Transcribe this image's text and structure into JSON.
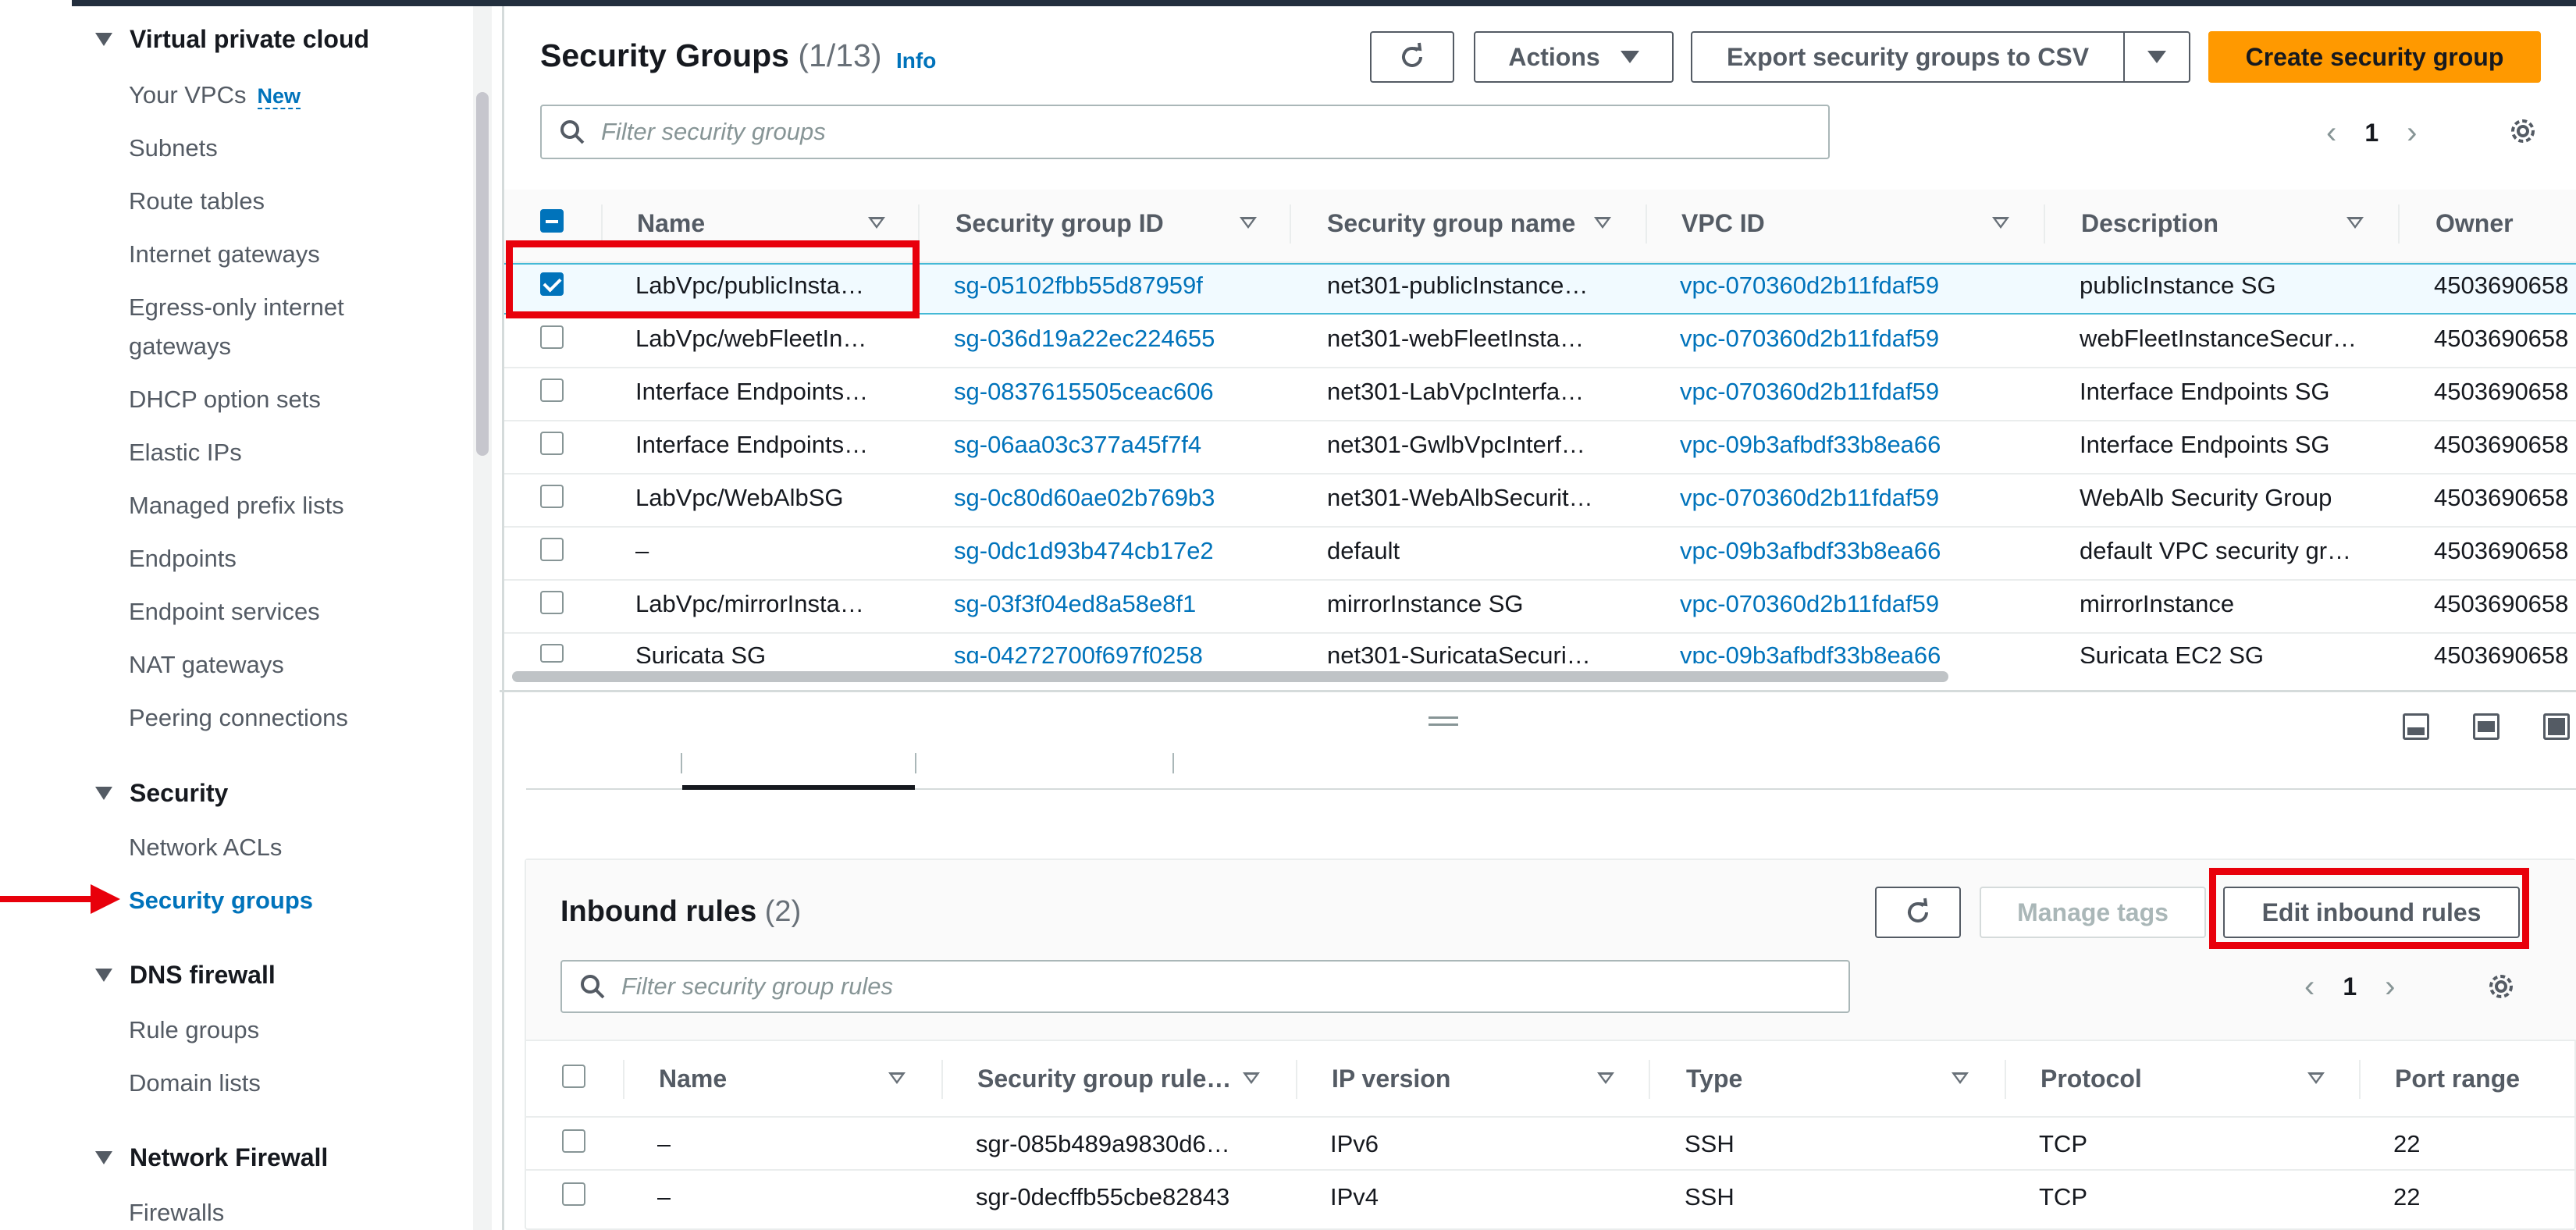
{
  "sidebar": {
    "sections": [
      {
        "label": "Virtual private cloud"
      },
      {
        "label": "Security"
      },
      {
        "label": "DNS firewall"
      },
      {
        "label": "Network Firewall"
      }
    ],
    "vpc_items": [
      {
        "label": "Your VPCs",
        "badge": "New"
      },
      {
        "label": "Subnets"
      },
      {
        "label": "Route tables"
      },
      {
        "label": "Internet gateways"
      },
      {
        "label": "Egress-only internet"
      },
      {
        "label": "gateways"
      },
      {
        "label": "DHCP option sets"
      },
      {
        "label": "Elastic IPs"
      },
      {
        "label": "Managed prefix lists"
      },
      {
        "label": "Endpoints"
      },
      {
        "label": "Endpoint services"
      },
      {
        "label": "NAT gateways"
      },
      {
        "label": "Peering connections"
      }
    ],
    "security_items": [
      {
        "label": "Network ACLs"
      },
      {
        "label": "Security groups"
      }
    ],
    "dns_items": [
      {
        "label": "Rule groups"
      },
      {
        "label": "Domain lists"
      }
    ],
    "nf_items": [
      {
        "label": "Firewalls"
      }
    ]
  },
  "security_groups": {
    "title": "Security Groups",
    "count": "(1/13)",
    "info": "Info",
    "actions_label": "Actions",
    "export_label": "Export security groups to CSV",
    "create_label": "Create security group",
    "filter_placeholder": "Filter security groups",
    "page": "1",
    "columns": [
      "Name",
      "Security group ID",
      "Security group name",
      "VPC ID",
      "Description",
      "Owner"
    ],
    "rows": [
      {
        "name": "LabVpc/publicInsta…",
        "id": "sg-05102fbb55d87959f",
        "sg_name": "net301-publicInstance…",
        "vpc": "vpc-070360d2b11fdaf59",
        "desc": "publicInstance SG",
        "owner": "4503690658"
      },
      {
        "name": "LabVpc/webFleetIn…",
        "id": "sg-036d19a22ec224655",
        "sg_name": "net301-webFleetInsta…",
        "vpc": "vpc-070360d2b11fdaf59",
        "desc": "webFleetInstanceSecur…",
        "owner": "4503690658"
      },
      {
        "name": "Interface Endpoints…",
        "id": "sg-0837615505ceac606",
        "sg_name": "net301-LabVpcInterfa…",
        "vpc": "vpc-070360d2b11fdaf59",
        "desc": "Interface Endpoints SG",
        "owner": "4503690658"
      },
      {
        "name": "Interface Endpoints…",
        "id": "sg-06aa03c377a45f7f4",
        "sg_name": "net301-GwlbVpcInterf…",
        "vpc": "vpc-09b3afbdf33b8ea66",
        "desc": "Interface Endpoints SG",
        "owner": "4503690658"
      },
      {
        "name": "LabVpc/WebAlbSG",
        "id": "sg-0c80d60ae02b769b3",
        "sg_name": "net301-WebAlbSecurit…",
        "vpc": "vpc-070360d2b11fdaf59",
        "desc": "WebAlb Security Group",
        "owner": "4503690658"
      },
      {
        "name": "–",
        "id": "sg-0dc1d93b474cb17e2",
        "sg_name": "default",
        "vpc": "vpc-09b3afbdf33b8ea66",
        "desc": "default VPC security gr…",
        "owner": "4503690658"
      },
      {
        "name": "LabVpc/mirrorInsta…",
        "id": "sg-03f3f04ed8a58e8f1",
        "sg_name": "mirrorInstance SG",
        "vpc": "vpc-070360d2b11fdaf59",
        "desc": "mirrorInstance",
        "owner": "4503690658"
      },
      {
        "name": "Suricata SG",
        "id": "sg-04272700f697f0258",
        "sg_name": "net301-SuricataSecuri…",
        "vpc": "vpc-09b3afbdf33b8ea66",
        "desc": "Suricata EC2 SG",
        "owner": "4503690658"
      }
    ]
  },
  "inbound": {
    "title": "Inbound rules",
    "count": "(2)",
    "manage_tags_label": "Manage tags",
    "edit_label": "Edit inbound rules",
    "filter_placeholder": "Filter security group rules",
    "page": "1",
    "columns": [
      "Name",
      "Security group rule…",
      "IP version",
      "Type",
      "Protocol",
      "Port range"
    ],
    "rows": [
      {
        "name": "–",
        "rule_id": "sgr-085b489a9830d6…",
        "ip": "IPv6",
        "type": "SSH",
        "protocol": "TCP",
        "port": "22"
      },
      {
        "name": "–",
        "rule_id": "sgr-0decffb55cbe82843",
        "ip": "IPv4",
        "type": "SSH",
        "protocol": "TCP",
        "port": "22"
      }
    ]
  },
  "colors": {
    "link": "#0073bb",
    "primary": "#ff9900",
    "highlight": "#e8000b"
  }
}
